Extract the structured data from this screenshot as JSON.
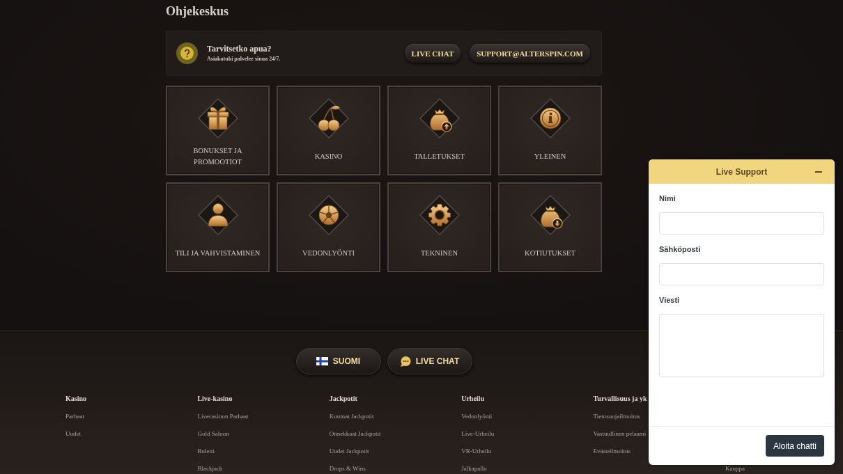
{
  "page_title": "Ohjekeskus",
  "help_bar": {
    "title": "Tarvitsetko apua?",
    "subtitle": "Asiakatuki palvelee sinua 24/7.",
    "buttons": [
      "LIVE CHAT",
      "SUPPORT@ALTERSPIN.COM"
    ]
  },
  "categories": [
    "BONUKSET JA PROMOOTIOT",
    "KASINO",
    "TALLETUKSET",
    "YLEINEN",
    "TILI JA VAHVISTAMINEN",
    "VEDONLYÖNTI",
    "TEKNINEN",
    "KOTIUTUKSET"
  ],
  "footer": {
    "buttons": [
      {
        "kind": "language",
        "label": "SUOMI"
      },
      {
        "kind": "chat",
        "label": "LIVE CHAT"
      }
    ],
    "columns": [
      {
        "heading": "Kasino",
        "links": [
          "Parhaat",
          "Uudet"
        ]
      },
      {
        "heading": "Live-kasino",
        "links": [
          "Livecasinon Parhaat",
          "Gold Saloon",
          "Ruletti",
          "Blackjack"
        ]
      },
      {
        "heading": "Jackpotit",
        "links": [
          "Kuumat Jackpotit",
          "Onnekkaat Jackpotit",
          "Uudet Jackpotit",
          "Drops & Wins"
        ]
      },
      {
        "heading": "Urheilu",
        "links": [
          "Vedonlyönti",
          "Live-Urheilu",
          "VR-Urheilu",
          "Jalkapallo"
        ]
      },
      {
        "heading": "Turvallisuus ja yk",
        "links": [
          "Tietosuojailmoitus",
          "Vastuullinen pelaami",
          "Evästeilmoitus"
        ]
      },
      {
        "links": [
          "Kauppa"
        ]
      }
    ]
  },
  "live_support": {
    "title": "Live Support",
    "fields": [
      {
        "kind": "input",
        "label": "Nimi"
      },
      {
        "kind": "input",
        "label": "Sähköposti"
      },
      {
        "kind": "textarea",
        "label": "Viesti"
      }
    ],
    "submit": "Aloita chatti"
  }
}
